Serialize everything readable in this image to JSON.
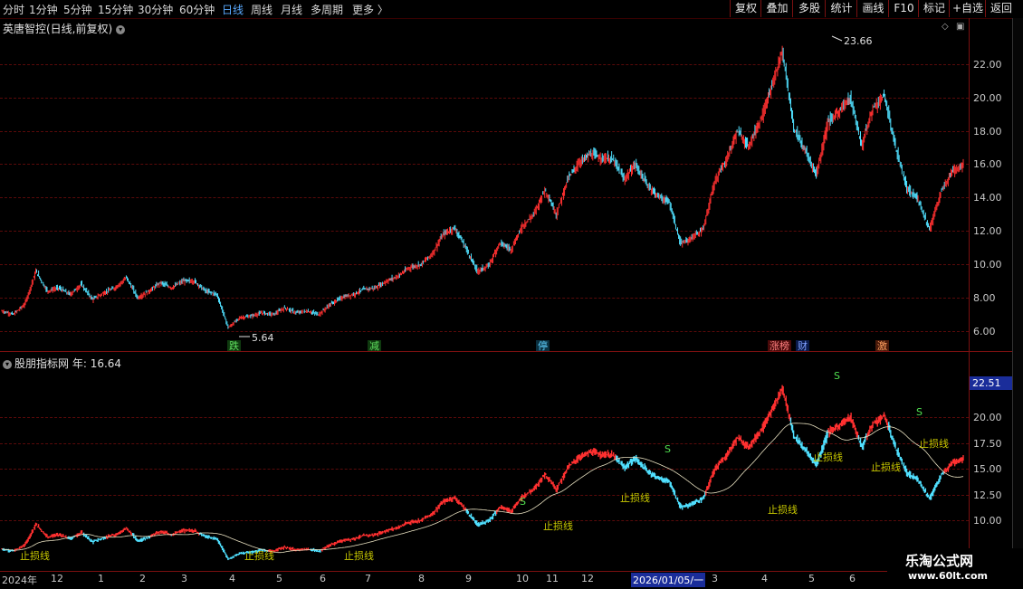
{
  "toolbar": {
    "periods": [
      "分时",
      "1分钟",
      "5分钟",
      "15分钟",
      "30分钟",
      "60分钟",
      "日线",
      "周线",
      "月线",
      "多周期",
      "更多 〉"
    ],
    "active_period": "日线",
    "buttons": [
      "复权",
      "叠加",
      "多股",
      "统计",
      "画线",
      "F10",
      "标记",
      "+自选",
      "返回"
    ]
  },
  "main_panel": {
    "title": "英唐智控(日线,前复权)",
    "y_ticks": [
      "22.00",
      "20.00",
      "18.00",
      "16.00",
      "14.00",
      "12.00",
      "10.00",
      "8.00",
      "6.00"
    ],
    "high_label": "23.66",
    "low_label": "5.64",
    "events": [
      {
        "text": "跌",
        "color": "#2a8a2a"
      },
      {
        "text": "减",
        "color": "#2a8a2a"
      },
      {
        "text": "停",
        "color": "#1a8aaa"
      },
      {
        "text": "涨榜",
        "color": "#c03030"
      },
      {
        "text": "财",
        "color": "#2a5aaa"
      },
      {
        "text": "激",
        "color": "#c05020"
      }
    ]
  },
  "sub_panel": {
    "title": "股朋指标网",
    "year_label": "年: 16.64",
    "current_value": "22.51",
    "y_ticks": [
      "20.00",
      "17.50",
      "15.00",
      "12.50",
      "10.00"
    ],
    "annotations": [
      "止损线",
      "S"
    ]
  },
  "date_axis": {
    "labels": [
      "2024年",
      "12",
      "1",
      "2",
      "3",
      "4",
      "5",
      "6",
      "7",
      "8",
      "9",
      "10",
      "11",
      "12",
      "2026/01/05/一",
      "3",
      "4",
      "5",
      "6"
    ]
  },
  "watermark": {
    "line1": "乐淘公式网",
    "line2": "www.60lt.com"
  },
  "colors": {
    "up": "#ff3030",
    "down": "#50e0ff",
    "grid": "#5a0a0a",
    "axis": "#7a1010",
    "active_tab": "#5aaaff"
  },
  "chart_data": [
    {
      "type": "candlestick",
      "title": "英唐智控(日线,前复权)",
      "ylim": [
        5.2,
        24.2
      ],
      "y_ticks": [
        6,
        8,
        10,
        12,
        14,
        16,
        18,
        20,
        22
      ],
      "annotations": [
        {
          "label": "23.66",
          "type": "max"
        },
        {
          "label": "5.64",
          "type": "min"
        }
      ],
      "close_trace": [
        7.2,
        7.0,
        7.6,
        9.6,
        8.4,
        8.6,
        8.2,
        8.8,
        7.9,
        8.3,
        8.6,
        9.2,
        8.0,
        8.4,
        8.9,
        8.6,
        9.0,
        9.0,
        8.4,
        8.2,
        6.2,
        6.8,
        6.9,
        7.1,
        7.0,
        7.4,
        7.1,
        7.2,
        7.0,
        7.6,
        8.0,
        8.2,
        8.5,
        8.6,
        9.0,
        9.3,
        9.8,
        10.0,
        10.6,
        11.8,
        12.2,
        11.0,
        9.6,
        9.9,
        11.3,
        10.9,
        12.3,
        13.0,
        14.5,
        13.0,
        15.1,
        16.1,
        16.6,
        16.4,
        16.3,
        15.1,
        16.0,
        14.8,
        14.1,
        13.7,
        11.2,
        11.6,
        12.1,
        15.0,
        16.2,
        18.0,
        17.1,
        18.6,
        20.5,
        22.8,
        18.2,
        16.8,
        15.4,
        18.5,
        19.2,
        20.0,
        17.1,
        19.4,
        20.1,
        17.0,
        14.5,
        13.9,
        12.1,
        14.3,
        15.6,
        16.0
      ]
    },
    {
      "type": "line",
      "title": "股朋指标网",
      "ylim": [
        8.4,
        24.4
      ],
      "y_ticks": [
        10,
        12.5,
        15,
        17.5,
        20
      ],
      "series": [
        {
          "name": "年",
          "values": [
            16.64
          ]
        }
      ]
    }
  ]
}
